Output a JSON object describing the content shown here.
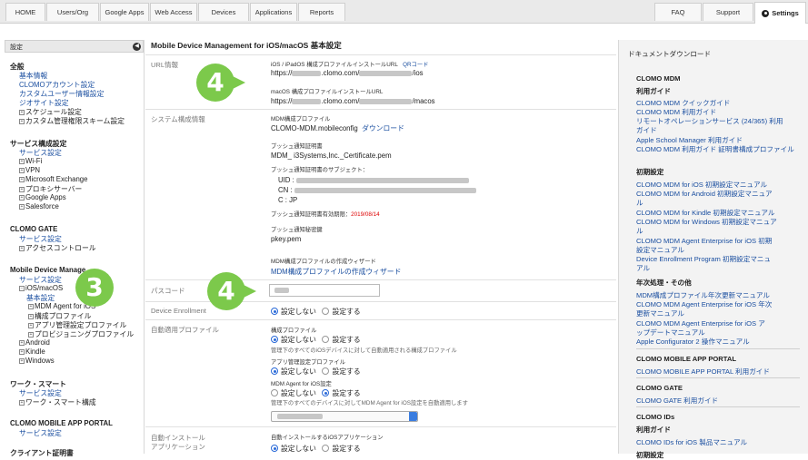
{
  "nav": {
    "home": "HOME",
    "users": "Users/Org",
    "google": "Google Apps",
    "web": "Web Access",
    "devices": "Devices",
    "apps": "Applications",
    "reports": "Reports",
    "faq": "FAQ",
    "support": "Support",
    "settings": "Settings"
  },
  "sidebar": {
    "header": "設定",
    "general": "全般",
    "basic": "基本情報",
    "clomo_account": "CLOMOアカウント設定",
    "custom_user": "カスタムユーザー情報設定",
    "geo": "ジオサイト設定",
    "schedule": "スケジュール設定",
    "custom_perm": "カスタム管理権限スキーム設定",
    "service_config": "サービス構成設定",
    "service_setting": "サービス設定",
    "wifi": "Wi-Fi",
    "vpn": "VPN",
    "exchange": "Microsoft Exchange",
    "proxy": "プロキシサーバー",
    "gapps": "Google Apps",
    "salesforce": "Salesforce",
    "gate": "CLOMO GATE",
    "gate_service": "サービス設定",
    "access": "アクセスコントロール",
    "mdm": "Mobile Device Manage",
    "mdm_service": "サービス設定",
    "ios": "iOS/macOS",
    "ios_basic": "基本設定",
    "agent": "MDM Agent for iOS",
    "profile": "構成プロファイル",
    "app_mgmt": "アプリ管理設定プロファイル",
    "provision": "プロビジョニングプロファイル",
    "android": "Android",
    "kindle": "Kindle",
    "windows": "Windows",
    "work": "ワーク・スマート",
    "work_service": "サービス設定",
    "work_config": "ワーク・スマート構成",
    "portal": "CLOMO MOBILE APP PORTAL",
    "portal_service": "サービス設定",
    "client": "クライアント証明書"
  },
  "main": {
    "title": "Mobile Device Management for iOS/macOS 基本設定",
    "url_label": "URL情報",
    "ios_url_title": "iOS / iPadOS 構成プロファイルインストールURL",
    "qr": "QRコード",
    "url_prefix": "https://",
    "url_domain": ".clomo.com/",
    "ios_suffix": "/ios",
    "mac_url_title": "macOS 構成プロファイルインストールURL",
    "mac_suffix": "/macos",
    "sys_label": "システム構成情報",
    "mdm_profile_title": "MDM構成プロファイル",
    "mdm_profile_value": "CLOMO-MDM.mobileconfig",
    "download": "ダウンロード",
    "push_cert_title": "プッシュ通知証明書",
    "push_cert_value": "MDM_ i3Systems,Inc._Certificate.pem",
    "subject_title": "プッシュ通知証明書のサブジェクト：",
    "uid": "UID  :",
    "cn": "CN  :",
    "c": "C   : JP",
    "expiry_label": "プッシュ通知証明書有効期限：",
    "expiry_date": "2019/08/14",
    "push_key_title": "プッシュ通知秘密鍵",
    "push_key_value": "pkey.pem",
    "wizard_title": "MDM構成プロファイルの作成ウィザード",
    "wizard_link": "MDM構成プロファイルの作成ウィザード",
    "passcode_label": "パスコード",
    "enrollment_label": "Device Enrollment",
    "no_setting": "設定しない",
    "do_setting": "設定する",
    "auto_profile_label": "自動適用プロファイル",
    "config_profile": "構成プロファイル",
    "config_profile_desc": "管理下のすべてのiOSデバイスに対して自動適用される構成プロファイル",
    "app_profile": "アプリ管理設定プロファイル",
    "agent_title": "MDM Agent for iOS設定",
    "agent_desc": "管理下のすべてのデバイスに対してMDM Agent for iOS設定を自動適用します",
    "auto_install_label1": "自動インストール",
    "auto_install_label2": "アプリケーション",
    "auto_install_title": "自動インストールするiOSアプリケーション"
  },
  "docs": {
    "header": "ドキュメントダウンロード",
    "mdm": "CLOMO MDM",
    "guide": "利用ガイド",
    "quick": "CLOMO MDM クイックガイド",
    "usage": "CLOMO MDM 利用ガイド",
    "remote1": "リモートオペレーションサービス (24/365) 利用",
    "remote2": "ガイド",
    "asm": "Apple School Manager 利用ガイド",
    "cert1": "CLOMO MDM 利用ガイド 証明書構成プロファイル",
    "cert2": "",
    "initial": "初期設定",
    "ios_init": "CLOMO MDM for iOS 初期設定マニュアル",
    "android_init1": "CLOMO MDM for Android 初期設定マニュア",
    "android_init2": "ル",
    "kindle_init": "CLOMO MDM for Kindle 初期設定マニュアル",
    "windows_init1": "CLOMO MDM for Windows 初期設定マニュア",
    "windows_init2": "ル",
    "agent_ent1": "CLOMO MDM Agent Enterprise for iOS 初期",
    "agent_ent2": "設定マニュアル",
    "dep1": "Device Enrollment Program 初期設定マニュ",
    "dep2": "アル",
    "annual": "年次処理・その他",
    "annual_profile": "MDM構成プロファイル年次更新マニュアル",
    "agent_annual1": "CLOMO MDM Agent Enterprise for iOS 年次",
    "agent_annual2": "更新マニュアル",
    "agent_update1": "CLOMO MDM Agent Enterprise for iOS ア",
    "agent_update2": "ップデートマニュアル",
    "configurator": "Apple Configurator 2 操作マニュアル",
    "portal": "CLOMO MOBILE APP PORTAL",
    "portal_guide": "CLOMO MOBILE APP PORTAL 利用ガイド",
    "gate": "CLOMO GATE",
    "gate_guide": "CLOMO GATE 利用ガイド",
    "ids": "CLOMO IDs",
    "ids_guide": "利用ガイド",
    "ids_ios": "CLOMO IDs for iOS 製品マニュアル",
    "ids_more": "初期設定"
  },
  "badges": {
    "b1": "4",
    "b2": "3",
    "b3": "4"
  },
  "colors": {
    "badge": "#7cc94b",
    "link": "#1b4fa0",
    "expiry": "#dd0000"
  }
}
